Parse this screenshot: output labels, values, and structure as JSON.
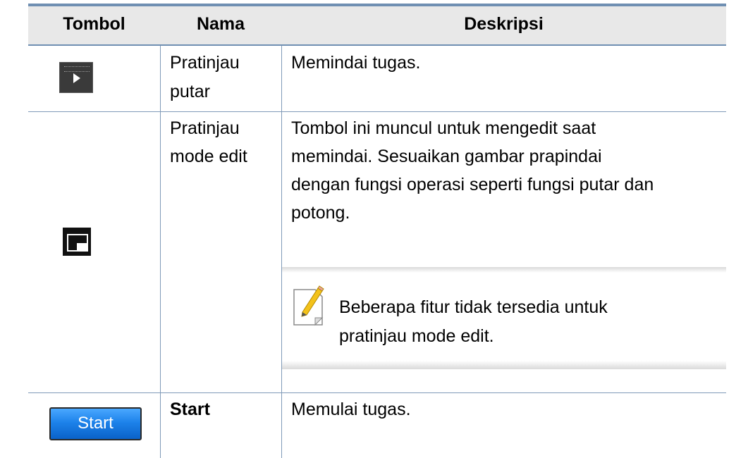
{
  "header": {
    "col1": "Tombol",
    "col2": "Nama",
    "col3": "Deskripsi"
  },
  "rows": [
    {
      "icon": "rotate-preview-icon",
      "name_line1": "Pratinjau",
      "name_line2": "putar",
      "desc": "Memindai tugas."
    },
    {
      "icon": "edit-mode-preview-icon",
      "name_line1": "Pratinjau",
      "name_line2": "mode edit",
      "desc_line1": "Tombol ini muncul untuk mengedit saat",
      "desc_line2": "memindai. Sesuaikan gambar prapindai",
      "desc_line3": "dengan fungsi operasi seperti fungsi putar dan",
      "desc_line4": "potong.",
      "note_icon": "note-pencil-icon",
      "note_line1": "Beberapa fitur tidak tersedia untuk",
      "note_line2": "pratinjau mode edit."
    },
    {
      "button_label": "Start",
      "name": "Start",
      "desc": "Memulai tugas."
    }
  ],
  "colors": {
    "rule": "#6f8fb2",
    "header_bg": "#e8e8e8",
    "start_button": "#1d82ea"
  }
}
